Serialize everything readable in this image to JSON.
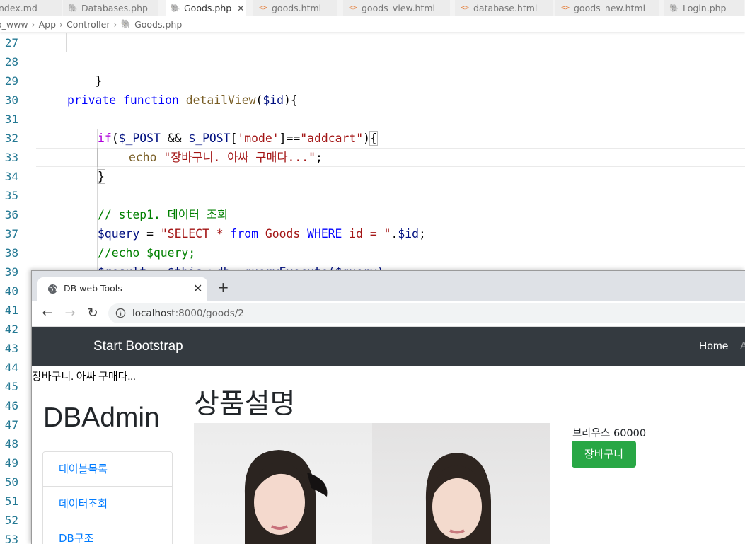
{
  "editor": {
    "tabs": [
      {
        "label": "ndex.md",
        "icon": "markdown-icon",
        "active": false
      },
      {
        "label": "Databases.php",
        "icon": "php-icon",
        "active": false
      },
      {
        "label": "Goods.php",
        "icon": "php-icon",
        "active": true
      },
      {
        "label": "goods.html",
        "icon": "html-icon",
        "active": false
      },
      {
        "label": "goods_view.html",
        "icon": "html-icon",
        "active": false
      },
      {
        "label": "database.html",
        "icon": "html-icon",
        "active": false
      },
      {
        "label": "goods_new.html",
        "icon": "html-icon",
        "active": false
      },
      {
        "label": "Login.php",
        "icon": "php-icon",
        "active": false
      }
    ],
    "breadcrumb": [
      "o_www",
      "App",
      "Controller",
      "Goods.php"
    ],
    "line_numbers": [
      "27",
      "28",
      "29",
      "30",
      "31",
      "32",
      "33",
      "34",
      "35",
      "36",
      "37",
      "38",
      "39",
      "40",
      "41",
      "42",
      "43",
      "44",
      "45",
      "46",
      "47",
      "48",
      "49",
      "50",
      "51",
      "52",
      "53"
    ],
    "code": {
      "l28": "}",
      "l30_kw1": "private",
      "l30_kw2": "function",
      "l30_fn": "detailView",
      "l30_open": "(",
      "l30_var": "$id",
      "l30_close": "){",
      "l32_if": "if",
      "l32_p1": "(",
      "l32_v1": "$_POST",
      "l32_and": " && ",
      "l32_v2": "$_POST",
      "l32_b1": "[",
      "l32_s1": "'mode'",
      "l32_eq": "]==",
      "l32_s2": "\"addcart\"",
      "l32_p2": ")",
      "l32_brace": "{",
      "l33_echo": "echo",
      "l33_str": "\"장바구니. 아싸 구매다...\"",
      "l33_end": ";",
      "l34": "}",
      "l36": "// step1. 데이터 조회",
      "l37_var": "$query",
      "l37_eq": " = ",
      "l37_s1": "\"SELECT * ",
      "l37_from": "from",
      "l37_tbl": " Goods ",
      "l37_where": "WHERE",
      "l37_s2": " id = \"",
      "l37_cat": ".",
      "l37_var2": "$id",
      "l37_end": ";",
      "l38": "//echo $query;",
      "l39": "$result = $this->db->queryExecute($query);"
    }
  },
  "browser": {
    "tab_title": "DB web Tools",
    "url_host": "localhost",
    "url_rest": ":8000/goods/2",
    "navbar": {
      "brand": "Start Bootstrap",
      "home": "Home",
      "more": "A"
    },
    "echo_output": "장바구니. 아싸 구매다...",
    "sidebar": {
      "title": "DBAdmin",
      "items": [
        "테이블목록",
        "데이터조회",
        "DB구조"
      ]
    },
    "page_title": "상품설명",
    "product_text": "브라우스 60000",
    "cart_button": "장바구니",
    "colors": {
      "navbar": "#343a40",
      "cart_button": "#28a745",
      "link": "#007bff"
    }
  }
}
